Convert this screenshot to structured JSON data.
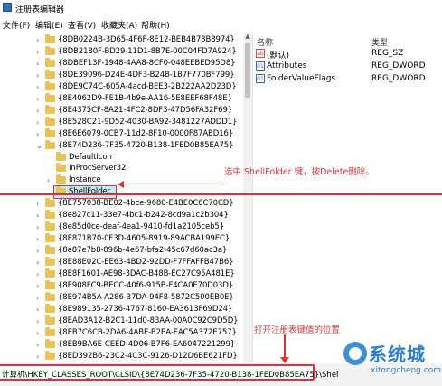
{
  "window": {
    "title": "注册表编辑器"
  },
  "menu": [
    "文件(F)",
    "编辑(E)",
    "查看(V)",
    "收藏夹(A)",
    "帮助(H)"
  ],
  "tree": [
    {
      "label": "{8DB0224B-3D65-4F6F-8E12-BEB4B78B8974}",
      "state": "collapsed"
    },
    {
      "label": "{8DB2180F-BD29-11D1-8B7E-00C04FD7A924}",
      "state": "collapsed"
    },
    {
      "label": "{8DBEF13F-1948-4AA8-8CF0-048EEBED95D8}",
      "state": "collapsed"
    },
    {
      "label": "{8DE39096-D24E-4DF3-B24B-1B7F770BF799}",
      "state": "collapsed"
    },
    {
      "label": "{8DE9C74C-605A-4acd-BEE3-2B222AA2D23D}",
      "state": "collapsed"
    },
    {
      "label": "{8E4062D9-FE1B-4b9e-AA16-5E8EEF68F48E}",
      "state": "collapsed"
    },
    {
      "label": "{8E4375CF-8A21-4FC2-8DF3-47D56FA32F69}",
      "state": "collapsed"
    },
    {
      "label": "{8E528C21-9D52-4030-BA92-3481227ADDD1}",
      "state": "collapsed"
    },
    {
      "label": "{8E6E6079-0CB7-11d2-8F10-0000F87ABD16}",
      "state": "collapsed"
    },
    {
      "label": "{8E74D236-7F35-4720-B138-1FED0B85EA75}",
      "state": "expanded"
    },
    {
      "label": "DefaultIcon",
      "state": "child"
    },
    {
      "label": "InProcServer32",
      "state": "child"
    },
    {
      "label": "Instance",
      "state": "child-collapsed"
    },
    {
      "label": "ShellFolder",
      "state": "selected"
    },
    {
      "label": "{8E757038-BE02-4bce-9680-E4BE0C6C70CD}",
      "state": "collapsed"
    },
    {
      "label": "{8e827c11-33e7-4bc1-b242-8cd9a1c2b304}",
      "state": "collapsed"
    },
    {
      "label": "{8e85d0ce-deaf-4ea1-9410-fd1a2105ceb5}",
      "state": "collapsed"
    },
    {
      "label": "{8E871B70-0F3D-4605-8919-89ACBA199EC}",
      "state": "collapsed"
    },
    {
      "label": "{8e87e7b8-896b-4e67-bfa2-45c67d60ac3a}",
      "state": "collapsed"
    },
    {
      "label": "{8E88E02C-EE63-4BD2-92DD-F7FFAFFB47B6}",
      "state": "collapsed"
    },
    {
      "label": "{8E8F1601-AE98-3DAC-B48B-EC27C95A481E}",
      "state": "collapsed"
    },
    {
      "label": "{8E908FC9-BECC-40f6-915B-F4CA0E70D03D}",
      "state": "collapsed"
    },
    {
      "label": "{8E974B5A-A286-37DA-94F8-5872C500EB0E}",
      "state": "collapsed"
    },
    {
      "label": "{8E989135-2736-4767-8160-EA3613F69D24}",
      "state": "collapsed"
    },
    {
      "label": "{8EAD3A12-B2C1-11d0-83AA-00A0C92C9D5D}",
      "state": "collapsed"
    },
    {
      "label": "{8EB7C6CB-2DA6-4ABE-B2EA-EAC5A372E757}",
      "state": "collapsed"
    },
    {
      "label": "{8EB9BA6E-CEED-4D06-B7F6-EA6047221299}",
      "state": "collapsed"
    },
    {
      "label": "{8ED392B6-23C2-4C3C-9126-D12D6BE621FD}",
      "state": "collapsed"
    }
  ],
  "list": {
    "header_name": "名称",
    "header_type": "类型",
    "values": [
      {
        "name": "(默认)",
        "type": "REG_SZ",
        "icon": "string-value-icon"
      },
      {
        "name": "Attributes",
        "type": "REG_DWORD",
        "icon": "dword-value-icon"
      },
      {
        "name": "FolderValueFlags",
        "type": "REG_DWORD",
        "icon": "dword-value-icon"
      }
    ]
  },
  "annotations": {
    "select_hint": "选中 ShellFolder 键，按Delete删除。",
    "path_hint": "打开注册表键值的位置"
  },
  "status": {
    "path": "计算机\\HKEY_CLASSES_ROOT\\CLSID\\{8E74D236-7F35-4720-B138-1FED0B85EA75}\\Shel"
  },
  "watermark": {
    "brand": "系统城",
    "url": "xitongcheng.com"
  },
  "colors": {
    "accent_red": "#d8333a",
    "watermark_blue": "#2a7fd0",
    "folder": "#e8c35a"
  }
}
